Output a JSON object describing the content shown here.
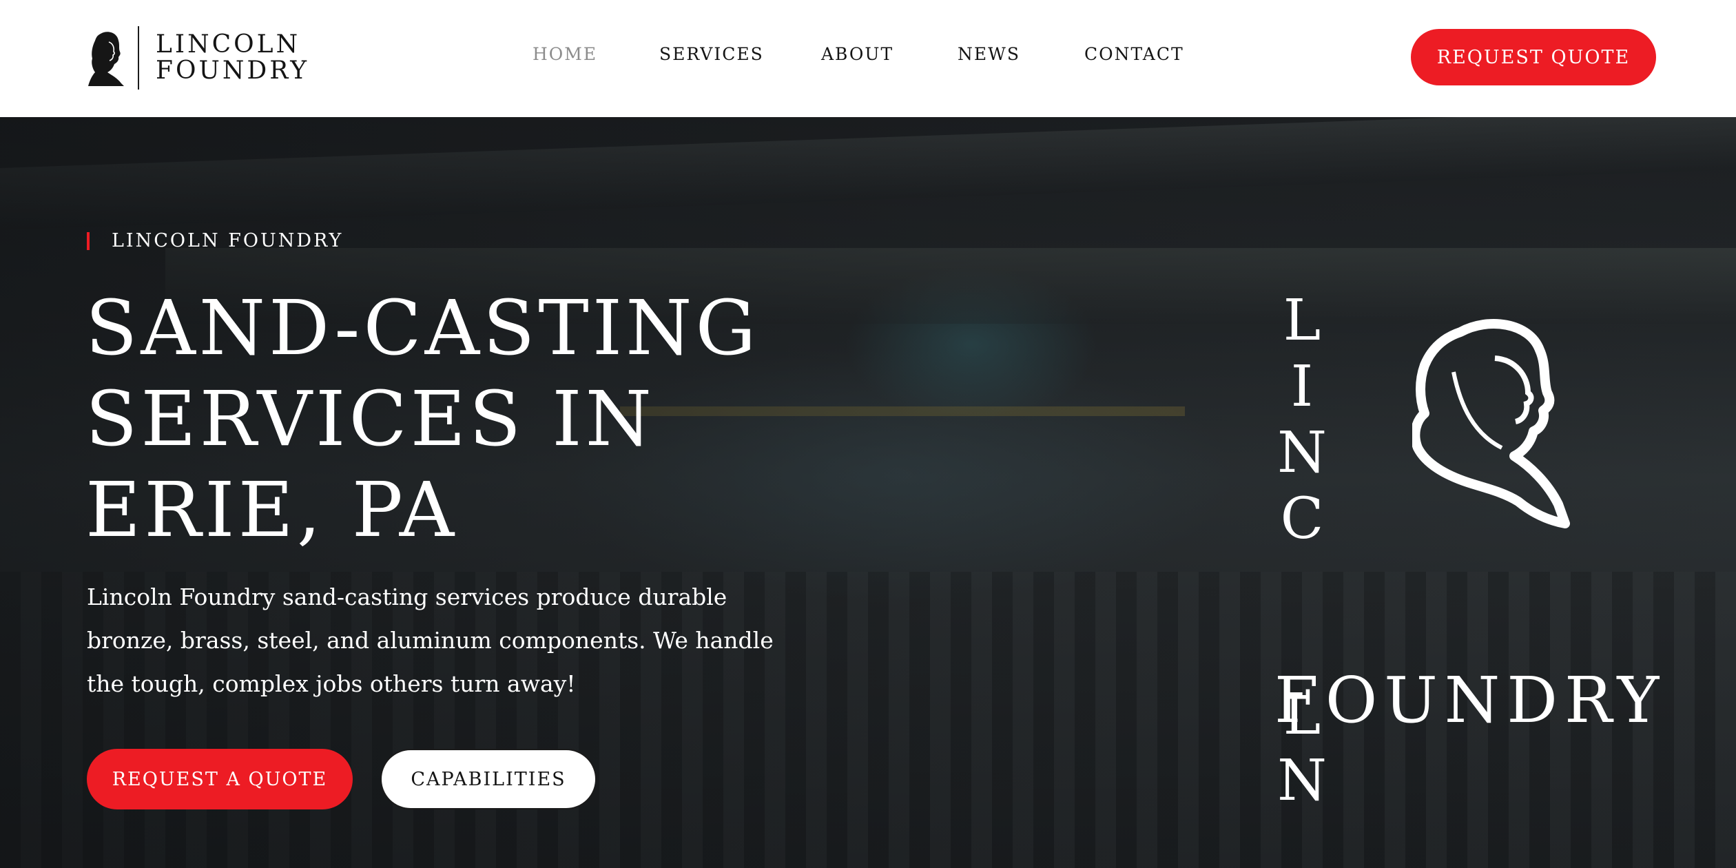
{
  "brand": {
    "line1": "LINCOLN",
    "line2": "FOUNDRY"
  },
  "nav": {
    "items": [
      {
        "label": "HOME",
        "active": true
      },
      {
        "label": "SERVICES",
        "active": false
      },
      {
        "label": "ABOUT",
        "active": false
      },
      {
        "label": "NEWS",
        "active": false
      },
      {
        "label": "CONTACT",
        "active": false
      }
    ],
    "cta": "REQUEST QUOTE"
  },
  "hero": {
    "eyebrow": "LINCOLN FOUNDRY",
    "title_lines": [
      "SAND-CASTING",
      "SERVICES IN",
      "ERIE, PA"
    ],
    "description": "Lincoln Foundry sand-casting services produce durable bronze, brass, steel, and aluminum components. We handle the tough, complex jobs others turn away!",
    "primary_button": "REQUEST A QUOTE",
    "secondary_button": "CAPABILITIES",
    "logo_vertical": "LINCOLN",
    "logo_horizontal": "FOUNDRY"
  },
  "colors": {
    "accent": "#ed1c24",
    "text_dark": "#141414",
    "nav_active": "#8c8c8c",
    "white": "#ffffff"
  },
  "icons": {
    "brand_mark": "lincoln-profile-icon"
  }
}
